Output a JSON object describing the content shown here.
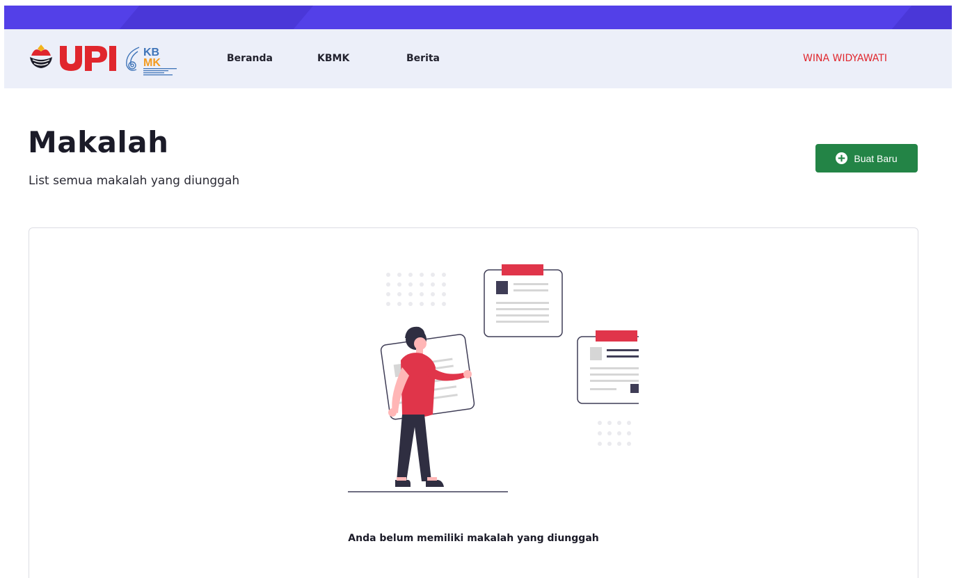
{
  "brand": {
    "name": "UPI",
    "sub_logo": "KBMK",
    "sub_logo_top": "KB",
    "sub_logo_bottom": "MK",
    "colors": {
      "upi_red": "#e0262d",
      "kbmk_blue": "#3f74b8",
      "kbmk_orange": "#f39a1f",
      "topband": "#5340e8"
    }
  },
  "nav": {
    "items": [
      {
        "label": "Beranda"
      },
      {
        "label": "KBMK",
        "dropdown_glyph": ""
      },
      {
        "label": "Berita"
      }
    ],
    "user": {
      "label": "WINA WIDYAWATI",
      "dropdown_glyph": ""
    }
  },
  "page": {
    "title": "Makalah",
    "subtitle": "List semua makalah yang diunggah",
    "new_button": {
      "label": "Buat Baru",
      "icon": "plus-circle-icon",
      "color": "#238446"
    }
  },
  "empty_state": {
    "illustration": "person-with-documents-illustration",
    "message": "Anda belum memiliki makalah yang diunggah"
  }
}
